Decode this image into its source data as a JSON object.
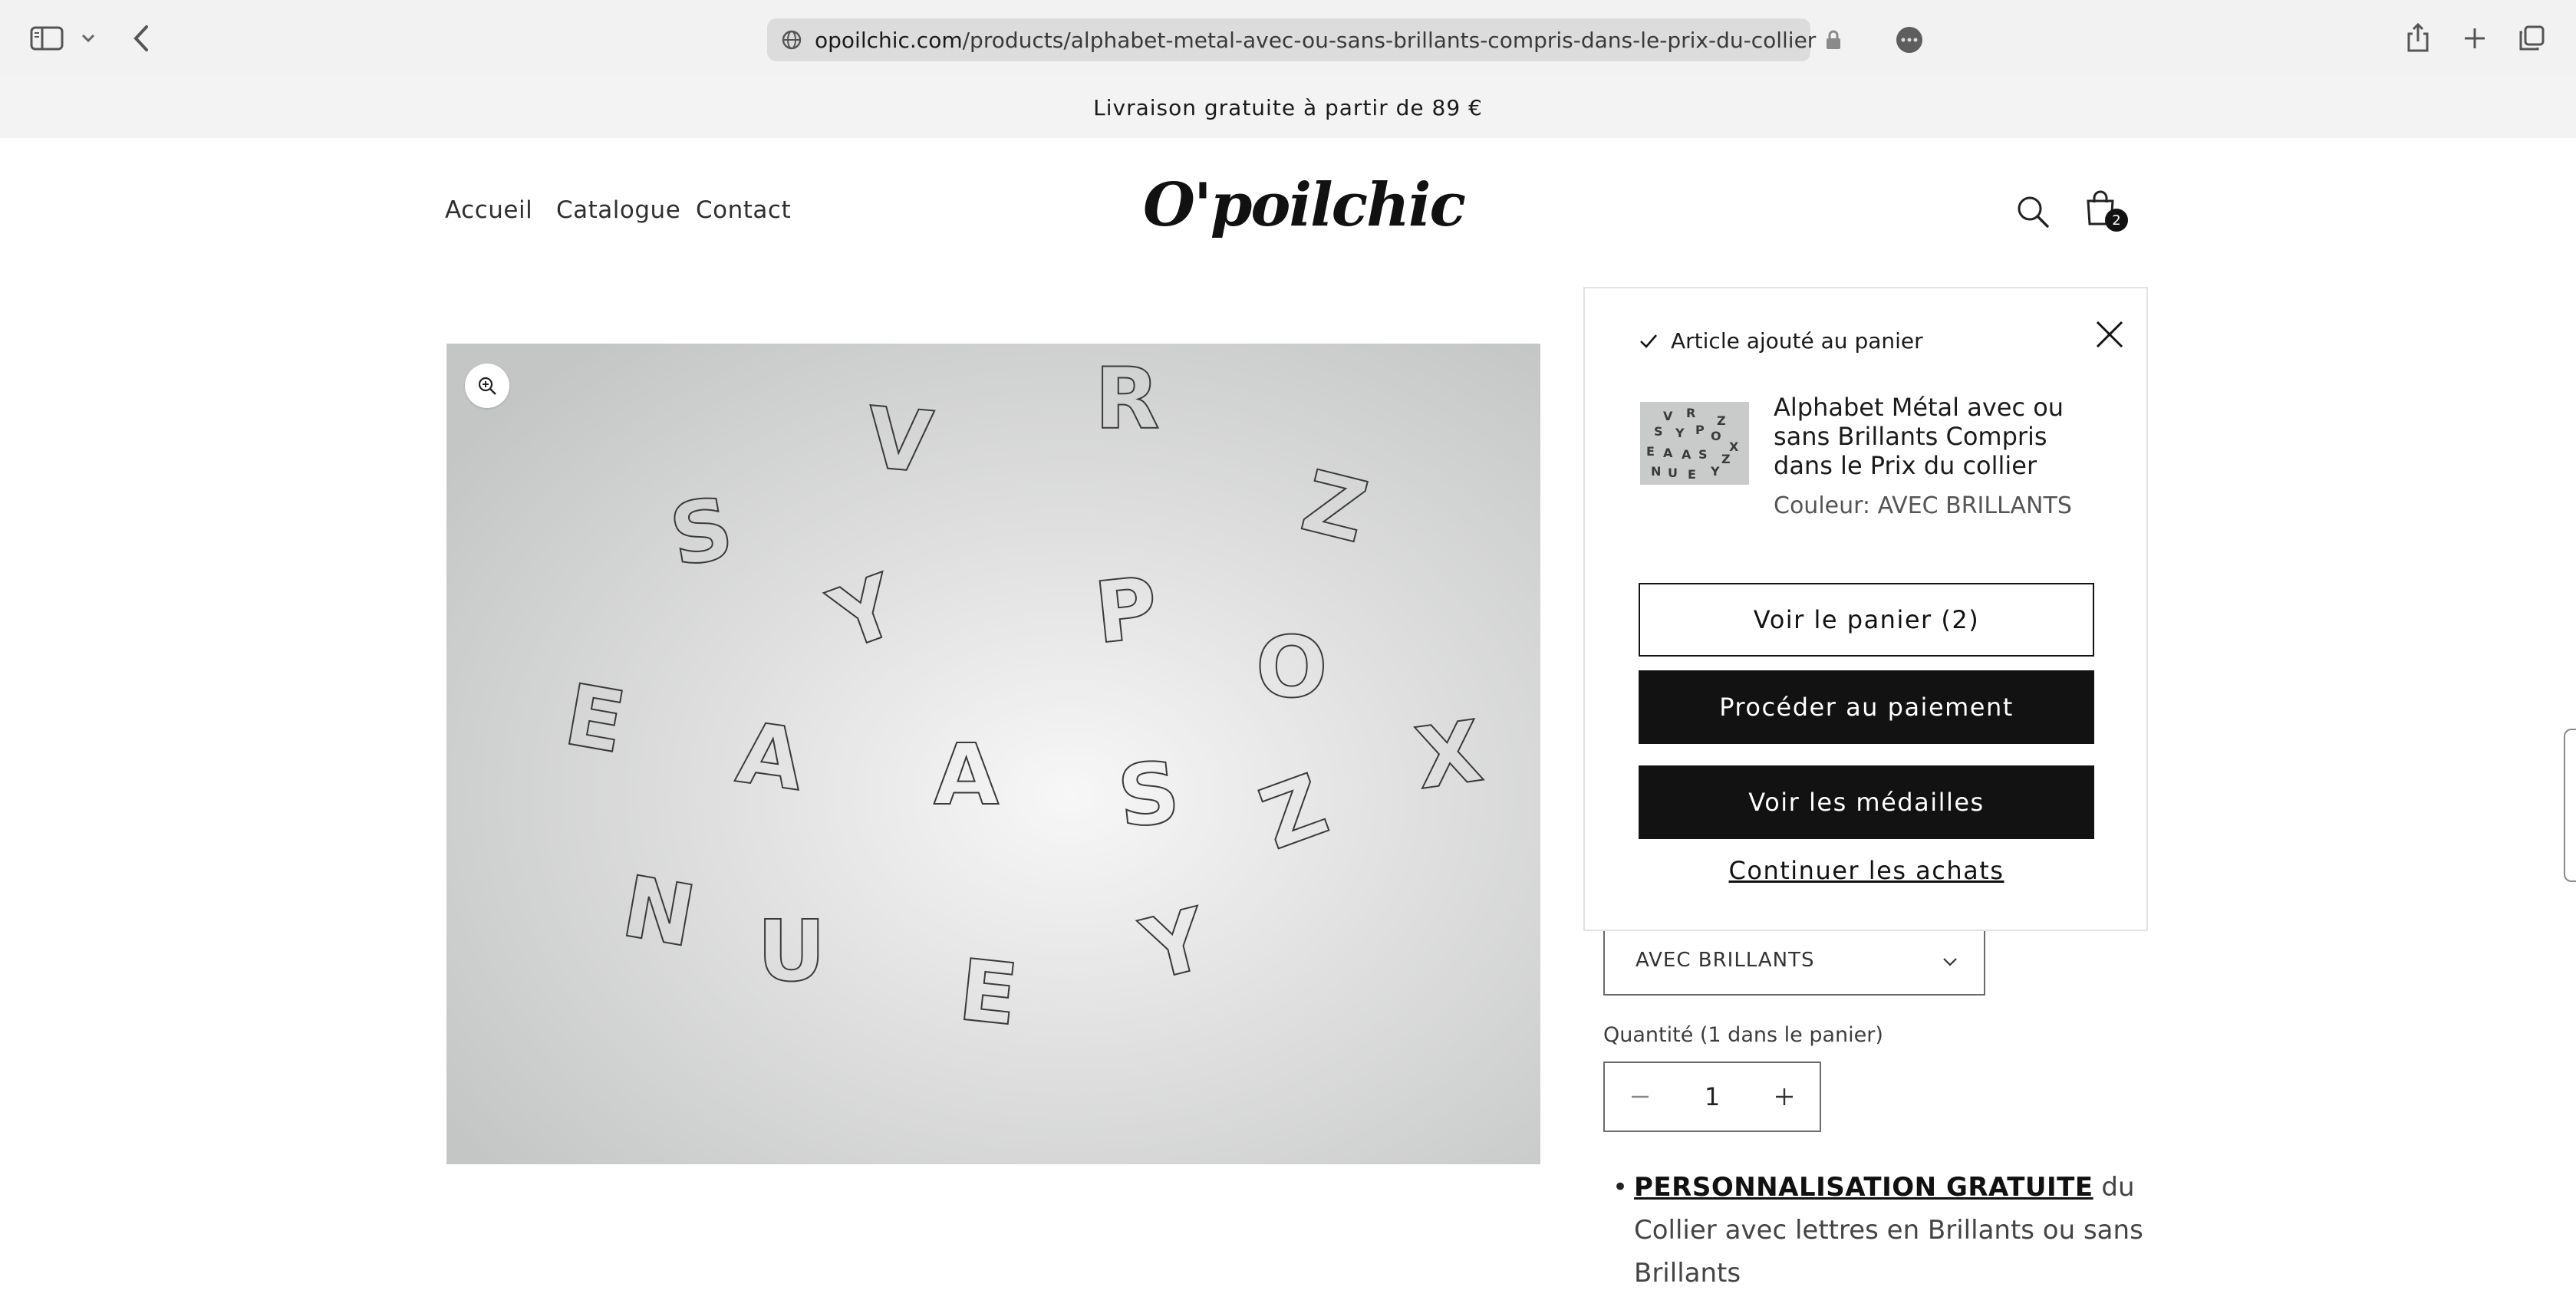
{
  "browser": {
    "url_domain": "opoilchic.com",
    "url_path": "/products/alphabet-metal-avec-ou-sans-brillants-compris-dans-le-prix-du-collier",
    "icons": [
      "sidebar-icon",
      "chevron-down-icon",
      "back-icon",
      "globe-icon",
      "lock-icon",
      "more-icon",
      "share-icon",
      "plus-icon",
      "tabs-icon"
    ]
  },
  "announcement": {
    "text": "Livraison gratuite à partir de 89 €"
  },
  "header": {
    "nav": [
      "Accueil",
      "Catalogue",
      "Contact"
    ],
    "logo": "O'poilchic",
    "cart_count": "2"
  },
  "product": {
    "image_letters": [
      "S",
      "V",
      "R",
      "Z",
      "Y",
      "P",
      "O",
      "E",
      "A",
      "A",
      "S",
      "X",
      "Z",
      "N",
      "U",
      "E",
      "Y"
    ],
    "variant_value": "AVEC BRILLANTS",
    "quantity_label": "Quantité (1 dans le panier)",
    "quantity": "1",
    "description": {
      "highlight": "PERSONNALISATION GRATUITE",
      "rest": " du Collier avec lettres en Brillants ou sans Brillants"
    }
  },
  "cart_popup": {
    "status": "Article ajouté au panier",
    "product_title": "Alphabet Métal avec ou sans Brillants Compris dans le Prix du collier",
    "product_variant": "Couleur: AVEC BRILLANTS",
    "view_cart_label": "Voir le panier (2)",
    "checkout_label": "Procéder au paiement",
    "medals_label": "Voir les médailles",
    "continue_label": "Continuer les achats"
  },
  "colors": {
    "primary": "#121212",
    "background": "#ffffff",
    "announcement_bg": "#f3f3f3",
    "chrome_bg": "#f2f2f2"
  }
}
